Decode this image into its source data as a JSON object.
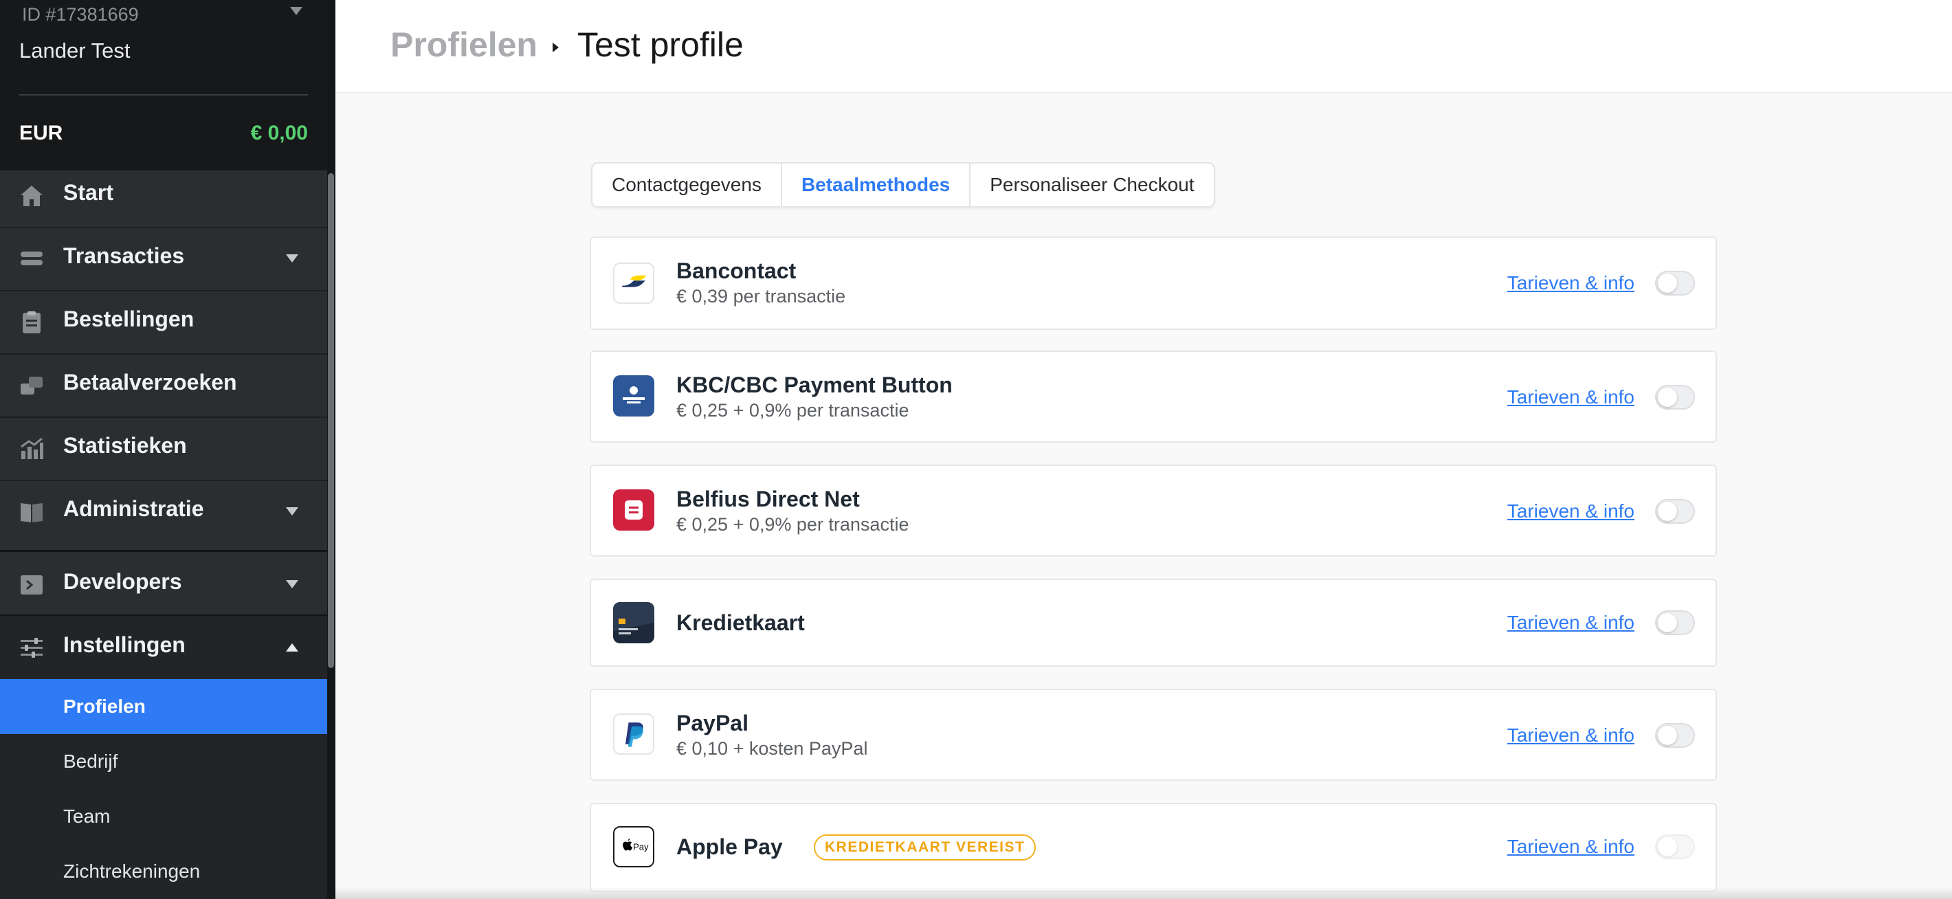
{
  "sidebar": {
    "org_id": "ID #17381669",
    "org_name": "Lander Test",
    "balance_currency": "EUR",
    "balance_amount": "€ 0,00",
    "items": [
      {
        "label": "Start",
        "icon": "home-icon"
      },
      {
        "label": "Transacties",
        "icon": "stack-icon"
      },
      {
        "label": "Bestellingen",
        "icon": "clipboard-icon"
      },
      {
        "label": "Betaalverzoeken",
        "icon": "payment-request-icon"
      },
      {
        "label": "Statistieken",
        "icon": "chart-icon"
      },
      {
        "label": "Administratie",
        "icon": "book-icon"
      },
      {
        "label": "Developers",
        "icon": "terminal-icon"
      },
      {
        "label": "Instellingen",
        "icon": "sliders-icon"
      }
    ],
    "sub_items": [
      {
        "label": "Profielen",
        "active": true
      },
      {
        "label": "Bedrijf"
      },
      {
        "label": "Team"
      },
      {
        "label": "Zichtrekeningen"
      }
    ]
  },
  "breadcrumb": {
    "parent": "Profielen",
    "current": "Test profile"
  },
  "tabs": [
    {
      "label": "Contactgegevens"
    },
    {
      "label": "Betaalmethodes",
      "active": true
    },
    {
      "label": "Personaliseer Checkout"
    }
  ],
  "payment_methods": [
    {
      "name": "Bancontact",
      "fee": "€ 0,39 per transactie",
      "link": "Tarieven & info",
      "enabled": false,
      "icon": "bancontact-icon"
    },
    {
      "name": "KBC/CBC Payment Button",
      "fee": "€ 0,25 + 0,9% per transactie",
      "link": "Tarieven & info",
      "enabled": false,
      "icon": "kbc-icon"
    },
    {
      "name": "Belfius Direct Net",
      "fee": "€ 0,25 + 0,9% per transactie",
      "link": "Tarieven & info",
      "enabled": false,
      "icon": "belfius-icon"
    },
    {
      "name": "Kredietkaart",
      "fee": "",
      "link": "Tarieven & info",
      "enabled": false,
      "icon": "creditcard-icon"
    },
    {
      "name": "PayPal",
      "fee": "€ 0,10 + kosten PayPal",
      "link": "Tarieven & info",
      "enabled": false,
      "icon": "paypal-icon"
    },
    {
      "name": "Apple Pay",
      "fee": "",
      "badge": "KREDIETKAART VEREIST",
      "link": "Tarieven & info",
      "enabled": false,
      "icon": "apple-pay-icon",
      "icon_text": "Pay"
    }
  ],
  "colors": {
    "accent": "#2f7bf5",
    "balance": "#56d271",
    "sidebar": "#2b2d31",
    "badge": "#f2a40e"
  }
}
